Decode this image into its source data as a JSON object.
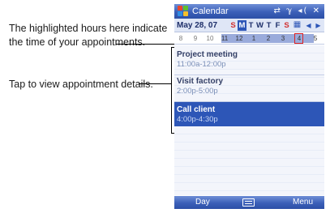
{
  "callouts": {
    "hours": "The highlighted hours here indicate the time of your appointments.",
    "details": "Tap to view appointment details."
  },
  "titlebar": {
    "title": "Calendar",
    "start_icon": "windows-flag-icon",
    "status_icons": [
      "sync-icon",
      "signal-icon",
      "volume-icon",
      "close-icon"
    ],
    "status_glyphs": "⇄ ℽ ◂( ✕"
  },
  "date_row": {
    "date": "May 28, 07",
    "days": [
      "S",
      "M",
      "T",
      "W",
      "T",
      "F",
      "S"
    ],
    "selected_day_index": 1,
    "calendar_icon": "▦",
    "prev_arrow": "◀",
    "next_arrow": "▶"
  },
  "hour_bar": {
    "hours": [
      "8",
      "9",
      "10",
      "11",
      "12",
      "1",
      "2",
      "3",
      "4",
      "5"
    ],
    "current_hour": "4"
  },
  "appointments": [
    {
      "title": "Project meeting",
      "time": "11:00a-12:00p",
      "selected": false
    },
    {
      "title": "Visit factory",
      "time": "2:00p-5:00p",
      "selected": false
    },
    {
      "title": "Call client",
      "time": "4:00p-4:30p",
      "selected": true
    }
  ],
  "menubar": {
    "left_softkey": "Day",
    "right_softkey": "Menu",
    "center_icon": "keyboard-icon"
  },
  "colors": {
    "titlebar": "#3b5fb8",
    "selected": "#2d56b7",
    "hour_highlight": "#9aabdb",
    "now_marker": "#e02222"
  }
}
